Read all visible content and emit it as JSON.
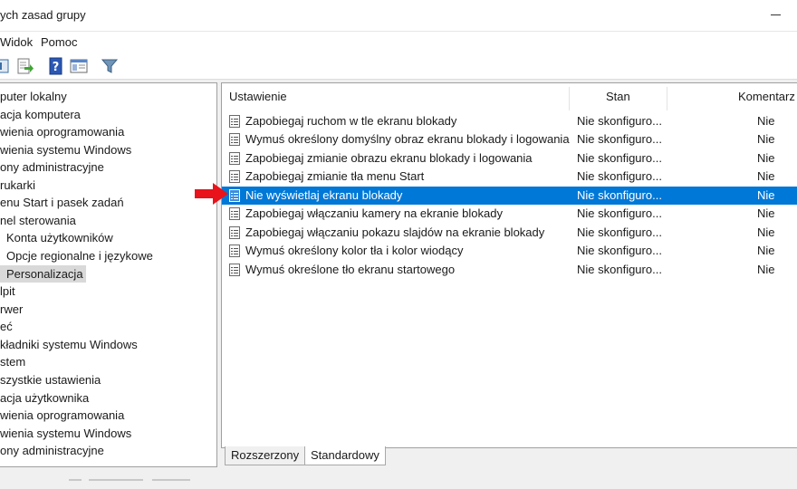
{
  "window": {
    "title": "ych zasad grupy"
  },
  "menu": {
    "items": [
      "Widok",
      "Pomoc"
    ]
  },
  "toolbar": {
    "buttons": [
      "view-icon",
      "export-list-icon",
      "help-icon",
      "properties-icon",
      "filter-icon"
    ]
  },
  "tree": {
    "items": [
      {
        "label": "puter lokalny",
        "indent": false,
        "selected": false
      },
      {
        "label": "acja komputera",
        "indent": false,
        "selected": false
      },
      {
        "label": "wienia oprogramowania",
        "indent": false,
        "selected": false
      },
      {
        "label": "wienia systemu Windows",
        "indent": false,
        "selected": false
      },
      {
        "label": "ony administracyjne",
        "indent": false,
        "selected": false
      },
      {
        "label": "rukarki",
        "indent": false,
        "selected": false
      },
      {
        "label": "enu Start i pasek zadań",
        "indent": false,
        "selected": false
      },
      {
        "label": "nel sterowania",
        "indent": false,
        "selected": false
      },
      {
        "label": "Konta użytkowników",
        "indent": true,
        "selected": false
      },
      {
        "label": "Opcje regionalne i językowe",
        "indent": true,
        "selected": false
      },
      {
        "label": "Personalizacja",
        "indent": true,
        "selected": true
      },
      {
        "label": "lpit",
        "indent": false,
        "selected": false
      },
      {
        "label": "rwer",
        "indent": false,
        "selected": false
      },
      {
        "label": "eć",
        "indent": false,
        "selected": false
      },
      {
        "label": "kładniki systemu Windows",
        "indent": false,
        "selected": false
      },
      {
        "label": "stem",
        "indent": false,
        "selected": false
      },
      {
        "label": "szystkie ustawienia",
        "indent": false,
        "selected": false
      },
      {
        "label": "acja użytkownika",
        "indent": false,
        "selected": false
      },
      {
        "label": "wienia oprogramowania",
        "indent": false,
        "selected": false
      },
      {
        "label": "wienia systemu Windows",
        "indent": false,
        "selected": false
      },
      {
        "label": "ony administracyjne",
        "indent": false,
        "selected": false
      }
    ]
  },
  "list": {
    "columns": {
      "setting": "Ustawienie",
      "state": "Stan",
      "comment": "Komentarz"
    },
    "rows": [
      {
        "name": "Zapobiegaj ruchom w tle ekranu blokady",
        "state": "Nie skonfiguro...",
        "comment": "Nie",
        "selected": false
      },
      {
        "name": "Wymuś określony domyślny obraz ekranu blokady i logowania",
        "state": "Nie skonfiguro...",
        "comment": "Nie",
        "selected": false
      },
      {
        "name": "Zapobiegaj zmianie obrazu ekranu blokady i logowania",
        "state": "Nie skonfiguro...",
        "comment": "Nie",
        "selected": false
      },
      {
        "name": "Zapobiegaj zmianie tła menu Start",
        "state": "Nie skonfiguro...",
        "comment": "Nie",
        "selected": false
      },
      {
        "name": "Nie wyświetlaj ekranu blokady",
        "state": "Nie skonfiguro...",
        "comment": "Nie",
        "selected": true
      },
      {
        "name": "Zapobiegaj włączaniu kamery na ekranie blokady",
        "state": "Nie skonfiguro...",
        "comment": "Nie",
        "selected": false
      },
      {
        "name": "Zapobiegaj włączaniu pokazu slajdów na ekranie blokady",
        "state": "Nie skonfiguro...",
        "comment": "Nie",
        "selected": false
      },
      {
        "name": "Wymuś określony kolor tła i kolor wiodący",
        "state": "Nie skonfiguro...",
        "comment": "Nie",
        "selected": false
      },
      {
        "name": "Wymuś określone tło ekranu startowego",
        "state": "Nie skonfiguro...",
        "comment": "Nie",
        "selected": false
      }
    ]
  },
  "tabs": [
    {
      "label": "Rozszerzony",
      "active": false
    },
    {
      "label": "Standardowy",
      "active": true
    }
  ],
  "colors": {
    "selection": "#0078d7",
    "annotation_arrow": "#e8131b",
    "tree_selection": "#d9d9d9"
  }
}
